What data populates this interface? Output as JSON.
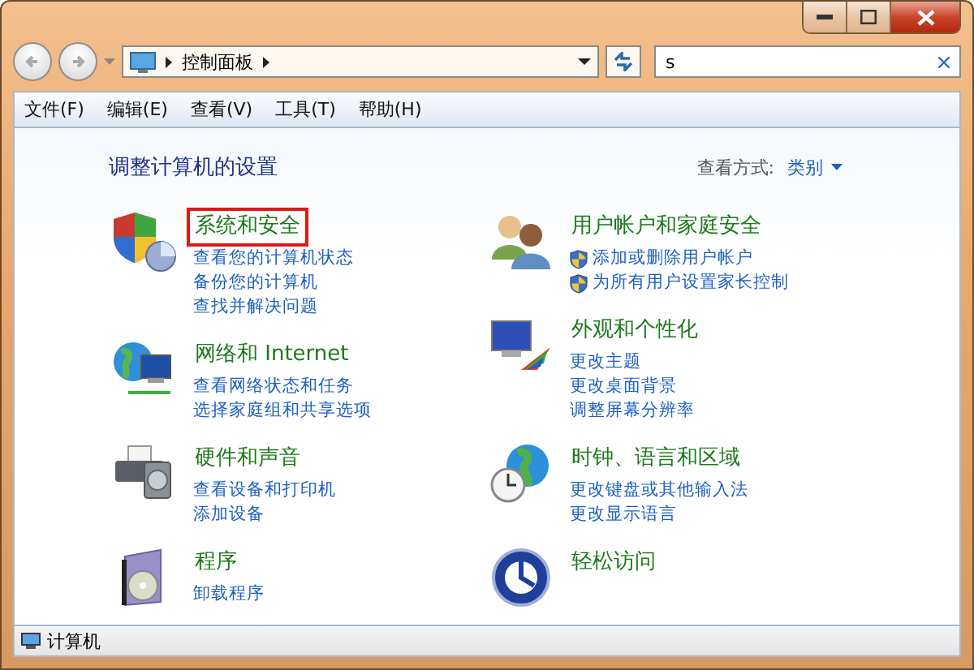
{
  "address": {
    "crumbs": [
      "控制面板"
    ]
  },
  "search": {
    "value": "s"
  },
  "menu": [
    "文件(F)",
    "编辑(E)",
    "查看(V)",
    "工具(T)",
    "帮助(H)"
  ],
  "heading": "调整计算机的设置",
  "view_by": {
    "label": "查看方式:",
    "value": "类别"
  },
  "columns": [
    [
      {
        "kind": "security",
        "title": "系统和安全",
        "highlighted": true,
        "links": [
          {
            "label": "查看您的计算机状态",
            "shield": false
          },
          {
            "label": "备份您的计算机",
            "shield": false
          },
          {
            "label": "查找并解决问题",
            "shield": false
          }
        ]
      },
      {
        "kind": "network",
        "title": "网络和 Internet",
        "highlighted": false,
        "links": [
          {
            "label": "查看网络状态和任务",
            "shield": false
          },
          {
            "label": "选择家庭组和共享选项",
            "shield": false
          }
        ]
      },
      {
        "kind": "hardware",
        "title": "硬件和声音",
        "highlighted": false,
        "links": [
          {
            "label": "查看设备和打印机",
            "shield": false
          },
          {
            "label": "添加设备",
            "shield": false
          }
        ]
      },
      {
        "kind": "programs",
        "title": "程序",
        "highlighted": false,
        "links": [
          {
            "label": "卸载程序",
            "shield": false
          }
        ]
      }
    ],
    [
      {
        "kind": "users",
        "title": "用户帐户和家庭安全",
        "highlighted": false,
        "links": [
          {
            "label": "添加或删除用户帐户",
            "shield": true
          },
          {
            "label": "为所有用户设置家长控制",
            "shield": true
          }
        ]
      },
      {
        "kind": "appearance",
        "title": "外观和个性化",
        "highlighted": false,
        "links": [
          {
            "label": "更改主题",
            "shield": false
          },
          {
            "label": "更改桌面背景",
            "shield": false
          },
          {
            "label": "调整屏幕分辨率",
            "shield": false
          }
        ]
      },
      {
        "kind": "clock",
        "title": "时钟、语言和区域",
        "highlighted": false,
        "links": [
          {
            "label": "更改键盘或其他输入法",
            "shield": false
          },
          {
            "label": "更改显示语言",
            "shield": false
          }
        ]
      },
      {
        "kind": "access",
        "title": "轻松访问",
        "highlighted": false
      }
    ]
  ],
  "status_bar": {
    "text": "计算机"
  }
}
